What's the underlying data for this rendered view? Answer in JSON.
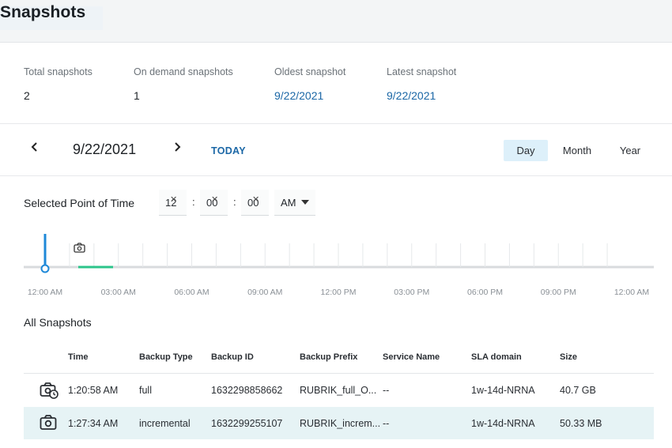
{
  "header": {
    "title": "Snapshots"
  },
  "stats": [
    {
      "label": "Total snapshots",
      "value": "2"
    },
    {
      "label": "On demand snapshots",
      "value": "1"
    },
    {
      "label": "Oldest snapshot",
      "value": "9/22/2021"
    },
    {
      "label": "Latest snapshot",
      "value": "9/22/2021"
    }
  ],
  "date_nav": {
    "prev_icon": "chevron-left-icon",
    "next_icon": "chevron-right-icon",
    "current_date": "9/22/2021",
    "today_label": "TODAY",
    "views": [
      "Day",
      "Month",
      "Year"
    ],
    "active_view": "Day"
  },
  "time_picker": {
    "label": "Selected Point of Time",
    "hour": "12",
    "minute": "00",
    "second": "00",
    "ampm": "AM",
    "clear_icon": "close-icon"
  },
  "timeline": {
    "tick_labels": [
      "12:00 AM",
      "03:00 AM",
      "06:00 AM",
      "09:00 AM",
      "12:00 PM",
      "03:00 PM",
      "06:00 PM",
      "09:00 PM",
      "12:00 AM"
    ],
    "colors": {
      "cursor": "#1e88d8",
      "coverage": "#2bc48a",
      "track": "#d8dbde"
    }
  },
  "table": {
    "title": "All Snapshots",
    "columns": [
      "Time",
      "Backup Type",
      "Backup ID",
      "Backup Prefix",
      "Service Name",
      "SLA domain",
      "Size"
    ],
    "rows": [
      {
        "icon": "camera-on-demand-icon",
        "time": "1:20:58 AM",
        "type": "full",
        "id": "1632298858662",
        "prefix": "RUBRIK_full_O...",
        "service": "--",
        "sla": "1w-14d-NRNA",
        "size": "40.7 GB",
        "selected": false
      },
      {
        "icon": "camera-icon",
        "time": "1:27:34 AM",
        "type": "incremental",
        "id": "1632299255107",
        "prefix": "RUBRIK_increm...",
        "service": "--",
        "sla": "1w-14d-NRNA",
        "size": "50.33 MB",
        "selected": true
      }
    ]
  }
}
